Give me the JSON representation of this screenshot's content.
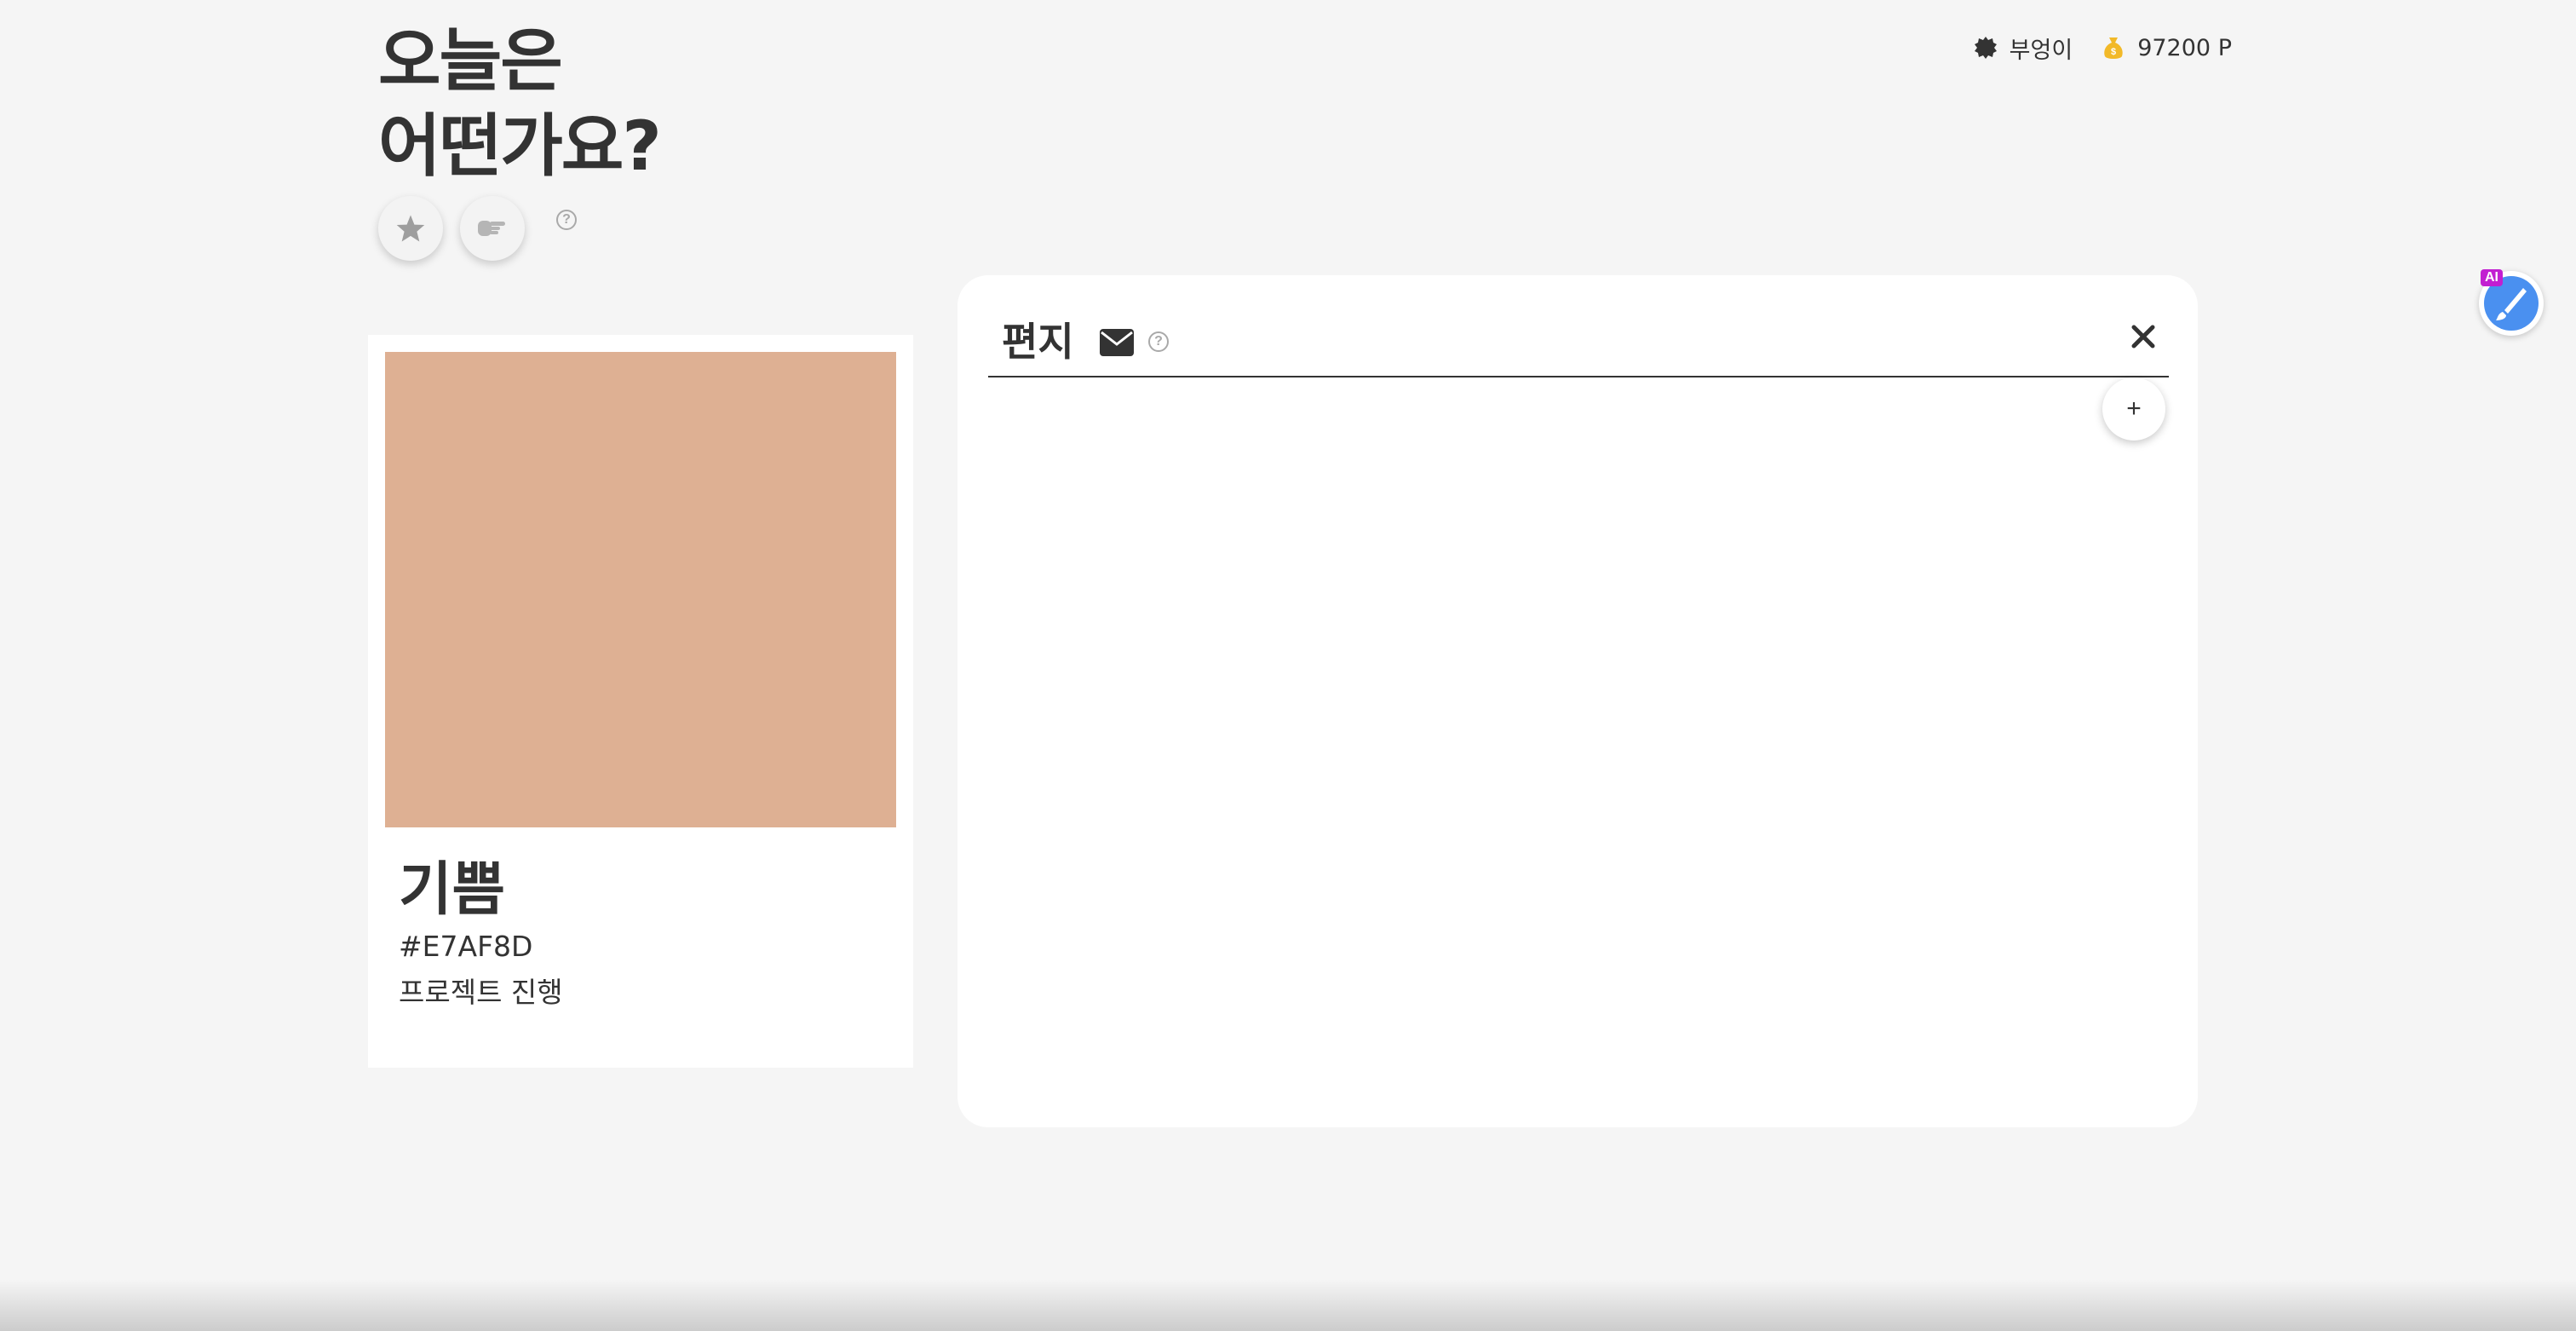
{
  "header": {
    "title_line1": "오늘은",
    "title_line2": "어떤가요?"
  },
  "topbar": {
    "nickname": "부엉이",
    "points": "97200",
    "points_unit": "P",
    "coin_color": "#f2b928"
  },
  "actions": {
    "star_icon": "star-icon",
    "hand_icon": "pointing-hand-icon",
    "help_text": "?"
  },
  "color_card": {
    "emotion": "기쁨",
    "hex": "#E7AF8D",
    "note": "프로젝트 진행",
    "swatch_color": "#deb093"
  },
  "letter_panel": {
    "title": "편지",
    "help_text": "?",
    "add_label": "+",
    "close_icon": "close-icon",
    "mail_icon": "envelope-icon"
  },
  "ai_widget": {
    "badge": "AI",
    "accent": "#4a90f0",
    "badge_color": "#c21fd1"
  }
}
